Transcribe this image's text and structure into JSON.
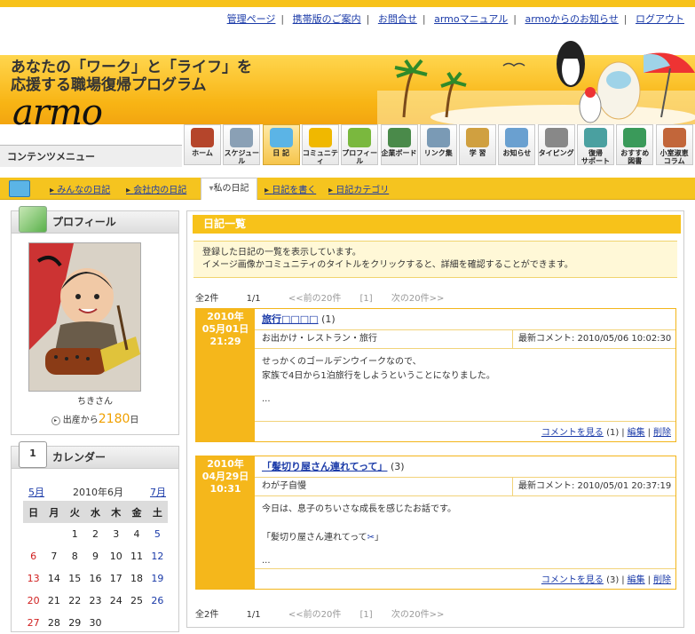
{
  "top_links": [
    "管理ページ",
    "携帯版のご案内",
    "お問合せ",
    "armoマニュアル",
    "armoからのお知らせ",
    "ログアウト"
  ],
  "header": {
    "tagline_line1": "あなたの「ワーク」と「ライフ」を",
    "tagline_line2": "応援する職場復帰プログラム",
    "logo": "armo"
  },
  "menu": {
    "title": "コンテンツメニュー",
    "items": [
      "ホーム",
      "スケジュール",
      "日 記",
      "コミュニティ",
      "プロフィール",
      "企業ボード",
      "リンク集",
      "学 習",
      "お知らせ",
      "タイピング",
      "復帰\nサポート",
      "おすすめ\n図書",
      "小室淑恵\nコラム"
    ],
    "active_index": 2
  },
  "subnav": {
    "items": [
      "みんなの日記",
      "会社内の日記",
      "私の日記",
      "日記を書く",
      "日記カテゴリ"
    ],
    "active": "私の日記"
  },
  "profile": {
    "heading": "プロフィール",
    "name": "ちきさん",
    "days_prefix": "出産から",
    "days": "2180",
    "days_suffix": "日"
  },
  "calendar": {
    "heading": "カレンダー",
    "prev": "5月",
    "month": "2010年6月",
    "next": "7月",
    "weekdays": [
      "日",
      "月",
      "火",
      "水",
      "木",
      "金",
      "土"
    ],
    "weeks": [
      [
        "",
        "",
        "1",
        "2",
        "3",
        "4",
        "5"
      ],
      [
        "6",
        "7",
        "8",
        "9",
        "10",
        "11",
        "12"
      ],
      [
        "13",
        "14",
        "15",
        "16",
        "17",
        "18",
        "19"
      ],
      [
        "20",
        "21",
        "22",
        "23",
        "24",
        "25",
        "26"
      ],
      [
        "27",
        "28",
        "29",
        "30",
        "",
        "",
        ""
      ]
    ]
  },
  "diary": {
    "heading": "日記一覧",
    "notice_line1": "登録した日記の一覧を表示しています。",
    "notice_line2": "イメージ画像かコミュニティのタイトルをクリックすると、詳細を確認することができます。",
    "pager": {
      "total": "全2件",
      "page": "1/1",
      "prev": "<<前の20件",
      "current": "[1]",
      "next": "次の20件>>"
    },
    "entries": [
      {
        "date_y": "2010年",
        "date_md": "05月01日",
        "time": "21:29",
        "title": "旅行□□□□",
        "count": "(1)",
        "category": "お出かけ・レストラン・旅行",
        "latest_comment": "最新コメント: 2010/05/06 10:02:30",
        "body1": "せっかくのゴールデンウイークなので、",
        "body2": "家族で4日から1泊旅行をしようということになりました。",
        "body3": "...",
        "comment_link": "コメントを見る",
        "comment_count": "(1)",
        "edit": "編集",
        "delete": "削除"
      },
      {
        "date_y": "2010年",
        "date_md": "04月29日",
        "time": "10:31",
        "title": "「髪切り屋さん連れてって」",
        "count": "(3)",
        "category": "わが子自慢",
        "latest_comment": "最新コメント: 2010/05/01 20:37:19",
        "body1": "今日は、息子のちいさな成長を感じたお話です。",
        "body2": "「髪切り屋さん連れてって",
        "body2_suffix": "」",
        "body3": "...",
        "comment_link": "コメントを見る",
        "comment_count": "(3)",
        "edit": "編集",
        "delete": "削除"
      }
    ]
  },
  "colors": {
    "accent": "#f5b71b",
    "link": "#1a3aa8",
    "days": "#f0a000"
  }
}
